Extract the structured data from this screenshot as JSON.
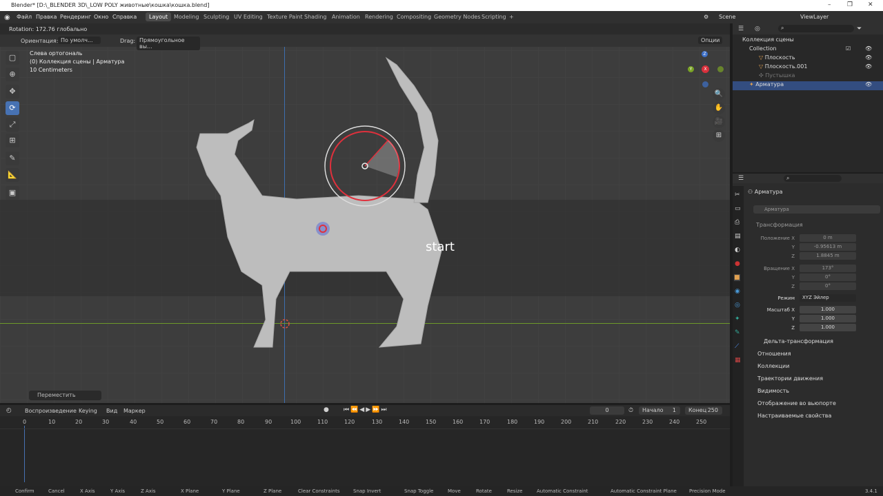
{
  "window": {
    "title": "Blender* [D:\\_BLENDER 3D\\_LOW POLY животные\\кошка\\кошка.blend]",
    "min": "–",
    "max": "❐",
    "close": "✕"
  },
  "menu": [
    "Файл",
    "Правка",
    "Рендеринг",
    "Окно",
    "Справка"
  ],
  "workspaces": [
    "Layout",
    "Modeling",
    "Sculpting",
    "UV Editing",
    "Texture Paint",
    "Shading",
    "Animation",
    "Rendering",
    "Compositing",
    "Geometry Nodes",
    "Scripting"
  ],
  "add_ws": "+",
  "scene": "Scene",
  "view_layer": "ViewLayer",
  "vp_header": {
    "rotation": "Rotation: 172.76 глобально"
  },
  "vp_header2": {
    "orient_label": "Ориентация:",
    "orient_value": "По умолч...",
    "drag_label": "Drag:",
    "drag_value": "Прямоугольное вы...",
    "options": "Опции"
  },
  "overlay": {
    "line1": "Слева ортогональ",
    "line2": "(0) Коллекция сцены | Арматура",
    "line3": "10 Centimeters"
  },
  "start_label": "start",
  "op_panel": "Переместить",
  "gizmo": {
    "x": "X",
    "y": "Y",
    "z": "Z"
  },
  "timeline": {
    "playback": "Воспроизведение",
    "keying": "Keying",
    "view": "Вид",
    "marker": "Маркер",
    "frame": "0",
    "start_label": "Начало",
    "start": "1",
    "end_label": "Конец",
    "end": "250",
    "ticks": [
      "0",
      "10",
      "20",
      "30",
      "40",
      "50",
      "60",
      "70",
      "80",
      "90",
      "100",
      "110",
      "120",
      "130",
      "140",
      "150",
      "160",
      "170",
      "180",
      "190",
      "200",
      "210",
      "220",
      "230",
      "240",
      "250"
    ]
  },
  "outliner": {
    "root": "Коллекция сцены",
    "collection": "Collection",
    "items": [
      "Плоскость",
      "Плоскость.001",
      "Пустышка",
      "Арматура"
    ]
  },
  "props": {
    "object_name": "Арматура",
    "data_name": "Арматура",
    "transform": "Трансформация",
    "loc_label": "Положение X",
    "loc": [
      "0 m",
      "-0.95613 m",
      "1.8845 m"
    ],
    "rot_label": "Вращение X",
    "rot": [
      "173°",
      "0°",
      "0°"
    ],
    "mode_label": "Режим",
    "mode": "XYZ Эйлер",
    "scale_label": "Масштаб X",
    "scale": [
      "1.000",
      "1.000",
      "1.000"
    ],
    "y": "Y",
    "z": "Z",
    "delta": "Дельта-трансформация",
    "sections": [
      "Отношения",
      "Коллекции",
      "Траектории движения",
      "Видимость",
      "Отображение во вьюпорте",
      "Настраиваемые свойства"
    ]
  },
  "status": [
    "Confirm",
    "Cancel",
    "X Axis",
    "Y Axis",
    "Z Axis",
    "X Plane",
    "Y Plane",
    "Z Plane",
    "Clear Constraints",
    "Snap Invert",
    "Snap Toggle",
    "Move",
    "Rotate",
    "Resize",
    "Automatic Constraint",
    "Automatic Constraint Plane",
    "Precision Mode"
  ],
  "version": "3.4.1"
}
